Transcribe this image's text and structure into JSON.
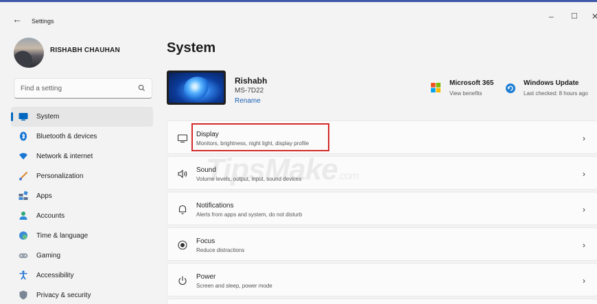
{
  "window": {
    "app_title": "Settings",
    "back_glyph": "←",
    "min_glyph": "–",
    "max_glyph": "☐",
    "close_glyph": "✕"
  },
  "profile": {
    "name": "RISHABH CHAUHAN"
  },
  "search": {
    "placeholder": "Find a setting",
    "icon": "search-icon"
  },
  "sidebar": {
    "items": [
      {
        "label": "System",
        "icon": "monitor-icon",
        "active": true
      },
      {
        "label": "Bluetooth & devices",
        "icon": "bluetooth-icon"
      },
      {
        "label": "Network & internet",
        "icon": "wifi-icon"
      },
      {
        "label": "Personalization",
        "icon": "brush-icon"
      },
      {
        "label": "Apps",
        "icon": "apps-icon"
      },
      {
        "label": "Accounts",
        "icon": "person-icon"
      },
      {
        "label": "Time & language",
        "icon": "globe-clock-icon"
      },
      {
        "label": "Gaming",
        "icon": "gamepad-icon"
      },
      {
        "label": "Accessibility",
        "icon": "accessibility-icon"
      },
      {
        "label": "Privacy & security",
        "icon": "shield-icon"
      }
    ]
  },
  "main": {
    "title": "System",
    "device": {
      "name": "Rishabh",
      "model": "MS-7D22",
      "rename": "Rename"
    },
    "microsoft365": {
      "title": "Microsoft 365",
      "subtitle": "View benefits"
    },
    "windows_update": {
      "title": "Windows Update",
      "subtitle": "Last checked: 8 hours ago"
    },
    "cards": [
      {
        "title": "Display",
        "subtitle": "Monitors, brightness, night light, display profile",
        "icon": "display-icon",
        "highlighted": true
      },
      {
        "title": "Sound",
        "subtitle": "Volume levels, output, input, sound devices",
        "icon": "speaker-icon"
      },
      {
        "title": "Notifications",
        "subtitle": "Alerts from apps and system, do not disturb",
        "icon": "bell-icon"
      },
      {
        "title": "Focus",
        "subtitle": "Reduce distractions",
        "icon": "focus-icon"
      },
      {
        "title": "Power",
        "subtitle": "Screen and sleep, power mode",
        "icon": "power-icon"
      }
    ],
    "chevron": "›"
  },
  "watermark": {
    "text": "TipsMake",
    "suffix": ".com"
  },
  "colors": {
    "accent": "#0067c0",
    "highlight": "#d32a2a",
    "window_border": "#3e57a8"
  }
}
